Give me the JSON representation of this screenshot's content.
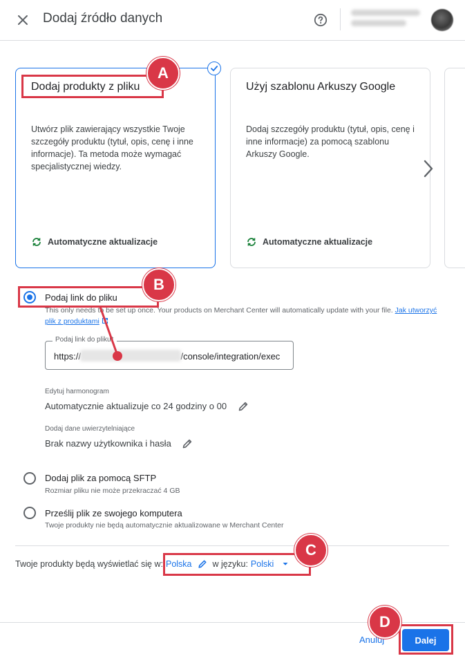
{
  "header": {
    "title": "Dodaj źródło danych",
    "close_icon": "close-icon",
    "help_icon": "help-circle-icon"
  },
  "cards": [
    {
      "title": "Dodaj produkty z pliku",
      "description": "Utwórz plik zawierający wszystkie Twoje szczegóły produktu (tytuł, opis, cenę i inne informacje). Ta metoda może wymagać specjalistycznej wiedzy.",
      "footer": "Automatyczne aktualizacje",
      "selected": true
    },
    {
      "title": "Użyj szablonu Arkuszy Google",
      "description": "Dodaj szczegóły produktu (tytuł, opis, cenę i inne informacje) za pomocą szablonu Arkuszy Google.",
      "footer": "Automatyczne aktualizacje",
      "selected": false
    }
  ],
  "options": {
    "link": {
      "label": "Podaj link do pliku",
      "selected": true,
      "helper": "This only needs to be set up once. Your products on Merchant Center will automatically update with your file.",
      "helper_link": "Jak utworzyć plik z produktami",
      "field_label": "Podaj link do pliku*",
      "field_value": "https://                                        /console/integration/exec",
      "schedule_label": "Edytuj harmonogram",
      "schedule_value": "Automatycznie aktualizuje co 24 godziny o 00",
      "credentials_label": "Dodaj dane uwierzytelniające",
      "credentials_value": "Brak nazwy użytkownika i hasła"
    },
    "sftp": {
      "label": "Dodaj plik za pomocą SFTP",
      "sub": "Rozmiar pliku nie może przekraczać 4 GB"
    },
    "upload": {
      "label": "Prześlij plik ze swojego komputera",
      "sub": "Twoje produkty nie będą automatycznie aktualizowane w Merchant Center"
    }
  },
  "locale": {
    "prefix": "Twoje produkty będą wyświetlać się w:",
    "country": "Polska",
    "mid": "w języku:",
    "language": "Polski"
  },
  "footer": {
    "cancel": "Anuluj",
    "next": "Dalej"
  },
  "annotations": {
    "a": "A",
    "b": "B",
    "c": "C",
    "d": "D",
    "color": "#d93747"
  },
  "colors": {
    "accent": "#1a73e8",
    "annotation": "#d93747"
  }
}
